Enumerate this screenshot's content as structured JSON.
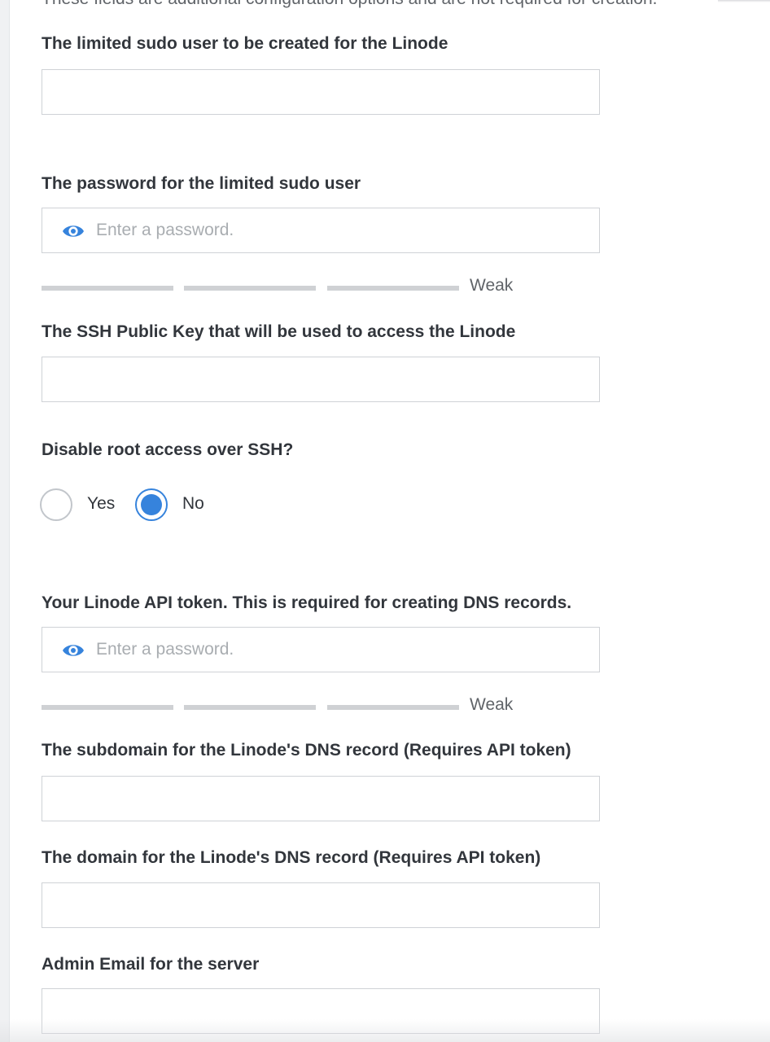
{
  "intro_text": "These fields are additional configuration options and are not required for creation.",
  "fields": {
    "sudo_user": {
      "label": "The limited sudo user to be created for the Linode",
      "value": ""
    },
    "sudo_password": {
      "label": "The password for the limited sudo user",
      "placeholder": "Enter a password.",
      "value": "",
      "strength": "Weak"
    },
    "ssh_key": {
      "label": "The SSH Public Key that will be used to access the Linode",
      "value": ""
    },
    "disable_root": {
      "label": "Disable root access over SSH?",
      "options": [
        {
          "label": "Yes",
          "checked": false
        },
        {
          "label": "No",
          "checked": true
        }
      ]
    },
    "api_token": {
      "label": "Your Linode API token. This is required for creating DNS records.",
      "placeholder": "Enter a password.",
      "value": "",
      "strength": "Weak"
    },
    "subdomain": {
      "label": "The subdomain for the Linode's DNS record (Requires API token)",
      "value": ""
    },
    "domain": {
      "label": "The domain for the Linode's DNS record (Requires API token)",
      "value": ""
    },
    "admin_email": {
      "label": "Admin Email for the server",
      "value": ""
    }
  },
  "icons": {
    "password_toggle": "eye-icon"
  },
  "colors": {
    "accent": "#3683dc",
    "border": "#cfd2d6",
    "label_text": "#32363c",
    "placeholder": "#a9adb1",
    "strength_bar": "#cfd1d4"
  }
}
